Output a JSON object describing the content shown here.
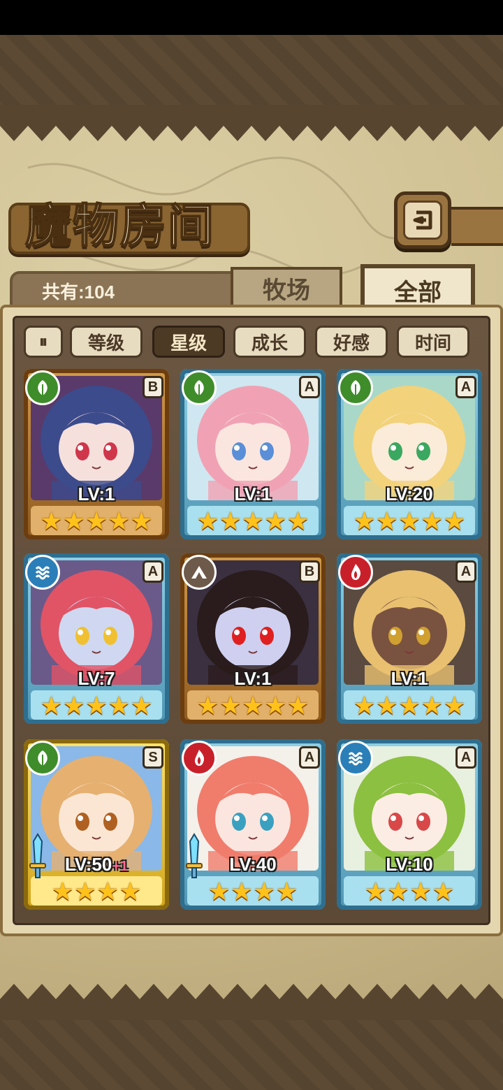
{
  "title": "魔物房间",
  "count_label": "共有:104",
  "tabs": [
    {
      "label": "牧场",
      "selected": false
    },
    {
      "label": "全部",
      "selected": true
    }
  ],
  "sort": {
    "toggle_icon": "sort-order-icon",
    "toggle_glyph": "⏸",
    "options": [
      {
        "label": "等级",
        "active": false
      },
      {
        "label": "星级",
        "active": true
      },
      {
        "label": "成长",
        "active": false
      },
      {
        "label": "好感",
        "active": false
      },
      {
        "label": "时间",
        "active": false
      }
    ]
  },
  "monsters": [
    {
      "level": "LV:1",
      "bonus": "",
      "rank": "B",
      "element": "nature",
      "stars": 5,
      "star_text": "★★★★★",
      "frame": "bronze",
      "equipped": false
    },
    {
      "level": "LV:1",
      "bonus": "",
      "rank": "A",
      "element": "nature",
      "stars": 5,
      "star_text": "★★★★★",
      "frame": "blue",
      "equipped": false
    },
    {
      "level": "LV:20",
      "bonus": "",
      "rank": "A",
      "element": "nature",
      "stars": 5,
      "star_text": "★★★★★",
      "frame": "blue",
      "equipped": false
    },
    {
      "level": "LV:7",
      "bonus": "",
      "rank": "A",
      "element": "water",
      "stars": 5,
      "star_text": "★★★★★",
      "frame": "blue",
      "equipped": false
    },
    {
      "level": "LV:1",
      "bonus": "",
      "rank": "B",
      "element": "earth",
      "stars": 5,
      "star_text": "★★★★★",
      "frame": "bronze",
      "equipped": false
    },
    {
      "level": "LV:1",
      "bonus": "",
      "rank": "A",
      "element": "fire",
      "stars": 5,
      "star_text": "★★★★★",
      "frame": "blue",
      "equipped": false
    },
    {
      "level": "LV:50",
      "bonus": "+1",
      "rank": "S",
      "element": "nature",
      "stars": 4,
      "star_text": "★★★★",
      "frame": "gold",
      "equipped": true
    },
    {
      "level": "LV:40",
      "bonus": "",
      "rank": "A",
      "element": "fire",
      "stars": 4,
      "star_text": "★★★★",
      "frame": "blue",
      "equipped": true
    },
    {
      "level": "LV:10",
      "bonus": "",
      "rank": "A",
      "element": "water",
      "stars": 4,
      "star_text": "★★★★",
      "frame": "blue",
      "equipped": false
    }
  ],
  "colors": {
    "nature": "#3f8c2a",
    "water": "#2b7fb8",
    "earth": "#6e5a4a",
    "fire": "#c8202a"
  },
  "portrait_palettes": [
    {
      "hair": "#3c4b8c",
      "skin": "#f6e0dc",
      "bg": "#5a3a6a",
      "eye": "#d0364b"
    },
    {
      "hair": "#f0a2b4",
      "skin": "#fbe6df",
      "bg": "#cfe7f0",
      "eye": "#5a8fd8"
    },
    {
      "hair": "#f2d27a",
      "skin": "#fbebd9",
      "bg": "#a9d8c8",
      "eye": "#3aa860"
    },
    {
      "hair": "#e05466",
      "skin": "#cfd8f0",
      "bg": "#6a5a8a",
      "eye": "#f0c030"
    },
    {
      "hair": "#2a1c1c",
      "skin": "#cfd0f0",
      "bg": "#3a3040",
      "eye": "#e02020"
    },
    {
      "hair": "#e8c070",
      "skin": "#7a5240",
      "bg": "#5a4a40",
      "eye": "#d0a030"
    },
    {
      "hair": "#e6b070",
      "skin": "#fbe6d4",
      "bg": "#8ab8e8",
      "eye": "#b06020"
    },
    {
      "hair": "#f07c6c",
      "skin": "#fbe6df",
      "bg": "#f4f0ea",
      "eye": "#3aa0c0"
    },
    {
      "hair": "#8cc040",
      "skin": "#fbece4",
      "bg": "#e8f0e0",
      "eye": "#d84848"
    }
  ]
}
